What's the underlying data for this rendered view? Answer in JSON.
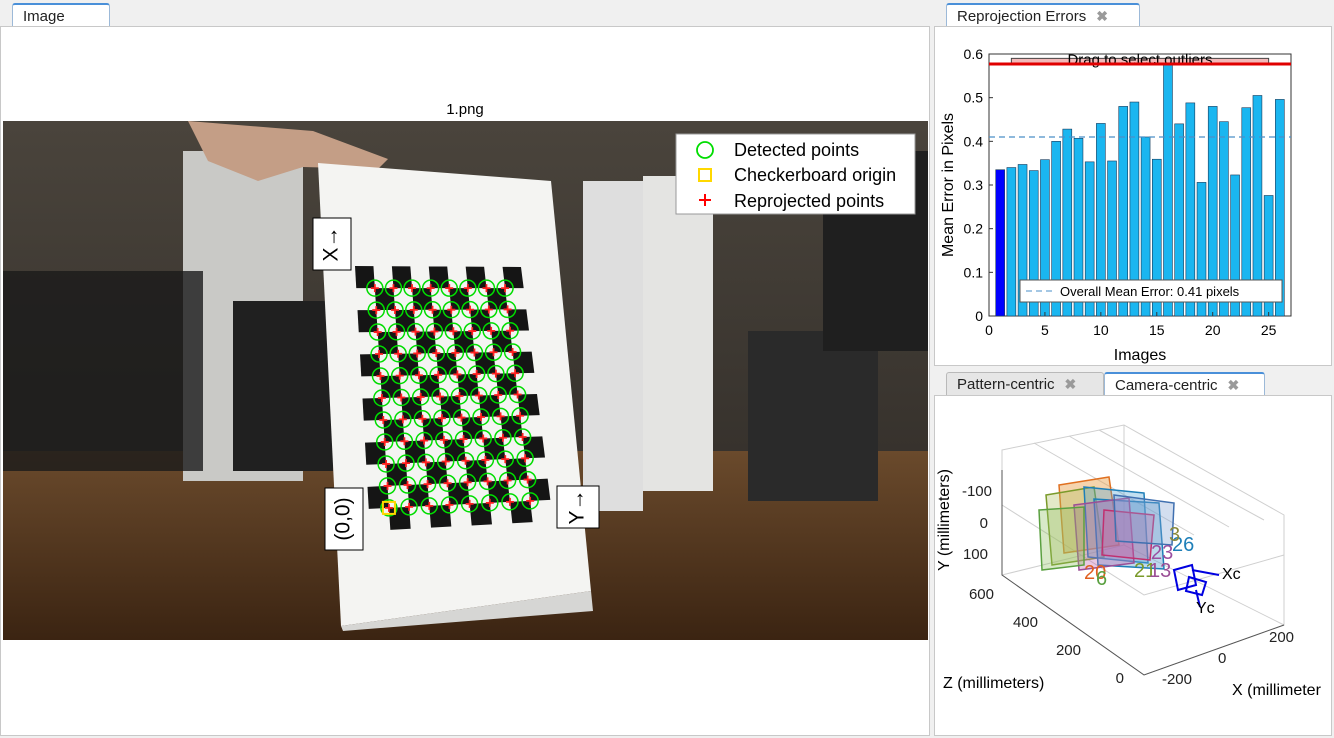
{
  "left_tab": {
    "label": "Image"
  },
  "image": {
    "title": "1.png",
    "axis_labels": {
      "x": "X→",
      "y": "Y→",
      "origin": "(0,0)"
    },
    "legend": [
      {
        "label": "Detected points",
        "color": "#00dd00"
      },
      {
        "label": "Checkerboard origin",
        "color": "#ffd800"
      },
      {
        "label": "Reprojected points",
        "color": "#ff0000"
      }
    ]
  },
  "errors_tab": {
    "label": "Reprojection Errors",
    "close_icon": "close-icon"
  },
  "chart_data": {
    "type": "bar",
    "title": "",
    "xlabel": "Images",
    "ylabel": "Mean Error in Pixels",
    "categories": [
      1,
      2,
      3,
      4,
      5,
      6,
      7,
      8,
      9,
      10,
      11,
      12,
      13,
      14,
      15,
      16,
      17,
      18,
      19,
      20,
      21,
      22,
      23,
      24,
      25,
      26
    ],
    "values": [
      0.335,
      0.34,
      0.347,
      0.333,
      0.358,
      0.4,
      0.428,
      0.407,
      0.353,
      0.441,
      0.355,
      0.48,
      0.49,
      0.41,
      0.359,
      0.577,
      0.44,
      0.488,
      0.306,
      0.48,
      0.445,
      0.323,
      0.477,
      0.505,
      0.276,
      0.496
    ],
    "selected_index": 0,
    "ylim": [
      0,
      0.6
    ],
    "xlim": [
      0,
      27
    ],
    "yticks": [
      "0",
      "0.1",
      "0.2",
      "0.3",
      "0.4",
      "0.5",
      "0.6"
    ],
    "xticks": [
      "0",
      "5",
      "10",
      "15",
      "20",
      "25"
    ],
    "mean_value": 0.41,
    "mean_label": "Overall Mean Error: 0.41 pixels",
    "threshold_value": 0.577,
    "drag_label": "Drag to select outliers",
    "colors": {
      "bar": "#1ab6f0",
      "selected_bar": "#0000ff",
      "threshold": "#e00000",
      "mean": "#4a8fc8"
    }
  },
  "views_tabs": [
    {
      "label": "Pattern-centric",
      "active": false
    },
    {
      "label": "Camera-centric",
      "active": true
    }
  ],
  "camera_view": {
    "y_axis_label": "Y (millimeters)",
    "z_axis_label": "Z (millimeters)",
    "x_axis_label": "X (millimeter",
    "y_ticks": [
      "-100",
      "0",
      "100"
    ],
    "z_ticks": [
      "600",
      "400",
      "200",
      "0"
    ],
    "x_ticks": [
      "-200",
      "0",
      "200"
    ],
    "pattern_labels": [
      {
        "text": "26",
        "color": "#1e7fb8"
      },
      {
        "text": "3",
        "color": "#8a8a3a"
      },
      {
        "text": "23",
        "color": "#9a4ea0"
      },
      {
        "text": "20",
        "color": "#e06020"
      },
      {
        "text": "21",
        "color": "#7a9a2a"
      },
      {
        "text": "6",
        "color": "#5aa040"
      },
      {
        "text": "13",
        "color": "#9b4f96"
      }
    ],
    "camera_axis_x": "Xc",
    "camera_axis_y": "Yc",
    "camera_color": "#0000e0"
  }
}
